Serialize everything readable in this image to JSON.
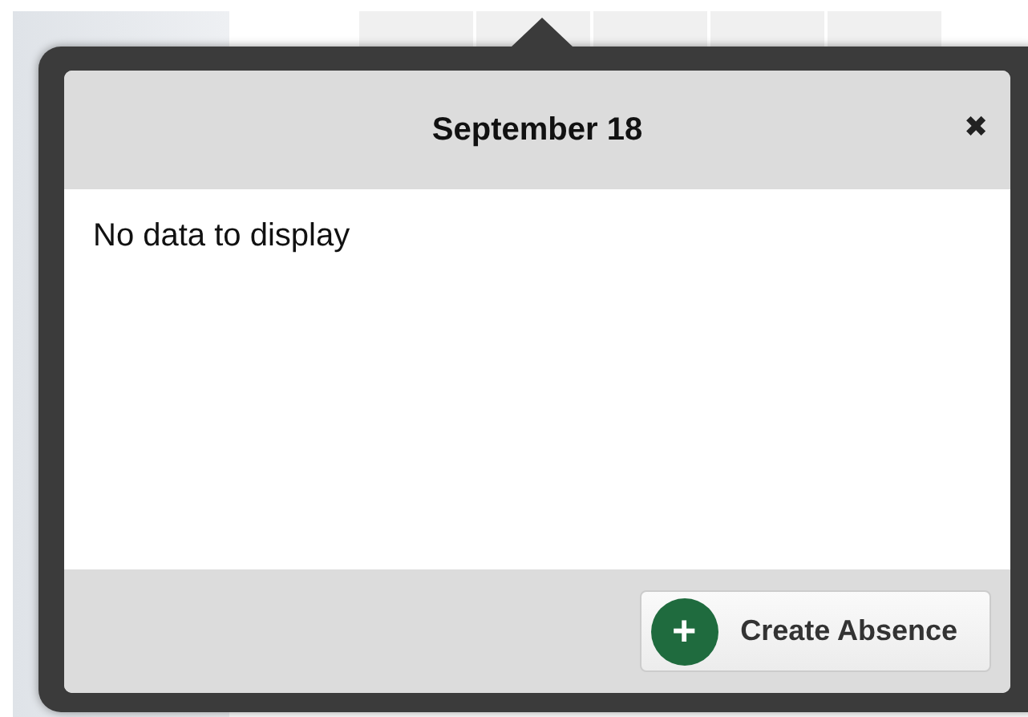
{
  "popup": {
    "title": "September 18",
    "close": "✖",
    "message": "No data to display",
    "buttons": [
      {
        "kind": "create",
        "icon": "+",
        "label": "Create Absence"
      }
    ]
  }
}
